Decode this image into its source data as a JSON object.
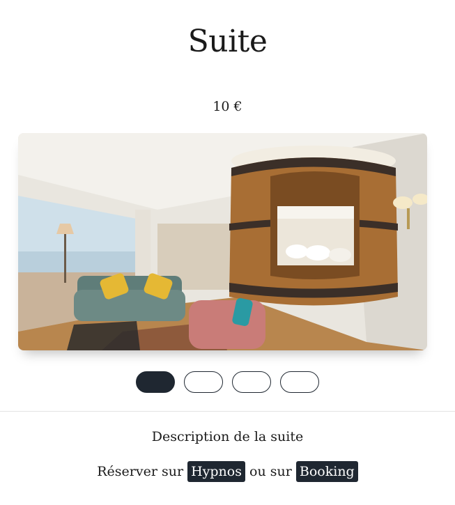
{
  "room": {
    "title": "Suite",
    "price": "10 €",
    "description": "Description de la suite"
  },
  "carousel": {
    "slide_count": 4,
    "active_index": 0
  },
  "booking": {
    "prefix": "Réserver sur",
    "hypnos_label": "Hypnos",
    "separator": "ou sur",
    "booking_label": "Booking"
  },
  "colors": {
    "accent": "#1f2731"
  }
}
